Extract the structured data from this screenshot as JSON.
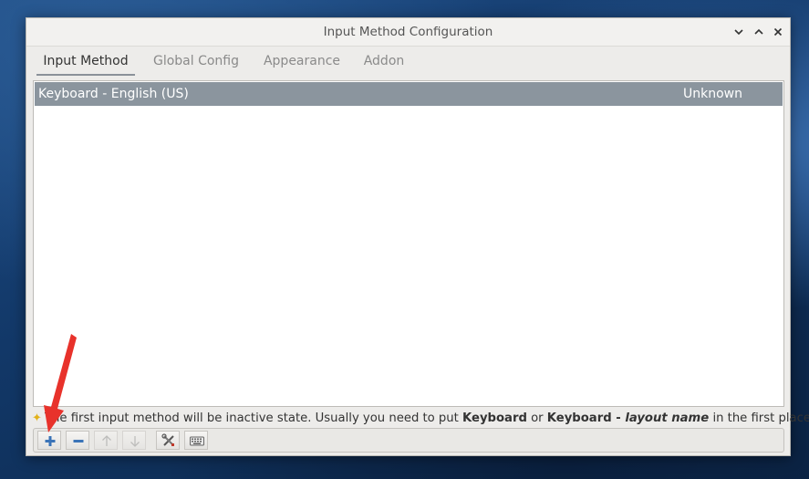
{
  "window": {
    "title": "Input Method Configuration"
  },
  "tabs": [
    {
      "label": "Input Method",
      "active": true
    },
    {
      "label": "Global Config",
      "active": false
    },
    {
      "label": "Appearance",
      "active": false
    },
    {
      "label": "Addon",
      "active": false
    }
  ],
  "input_methods": [
    {
      "name": "Keyboard - English (US)",
      "status": "Unknown",
      "selected": true
    }
  ],
  "hint": {
    "icon": "star-icon",
    "text_start": "The first input method will be inactive state. Usually you need to put ",
    "bold_1": "Keyboard",
    "middle": " or ",
    "bold_2": "Keyboard - ",
    "bold_italic": "layout name",
    "text_end": " in the first place."
  },
  "toolbar": {
    "buttons": [
      {
        "name": "add-button",
        "icon": "plus-icon"
      },
      {
        "name": "remove-button",
        "icon": "minus-icon"
      },
      {
        "name": "move-up-button",
        "icon": "arrow-up-icon",
        "disabled": true
      },
      {
        "name": "move-down-button",
        "icon": "arrow-down-icon",
        "disabled": true
      },
      {
        "name": "configure-button",
        "icon": "tools-icon"
      },
      {
        "name": "keyboard-layout-button",
        "icon": "keyboard-icon"
      }
    ]
  },
  "colors": {
    "selection": "#8b959e",
    "annotation_arrow": "#e8322b"
  }
}
